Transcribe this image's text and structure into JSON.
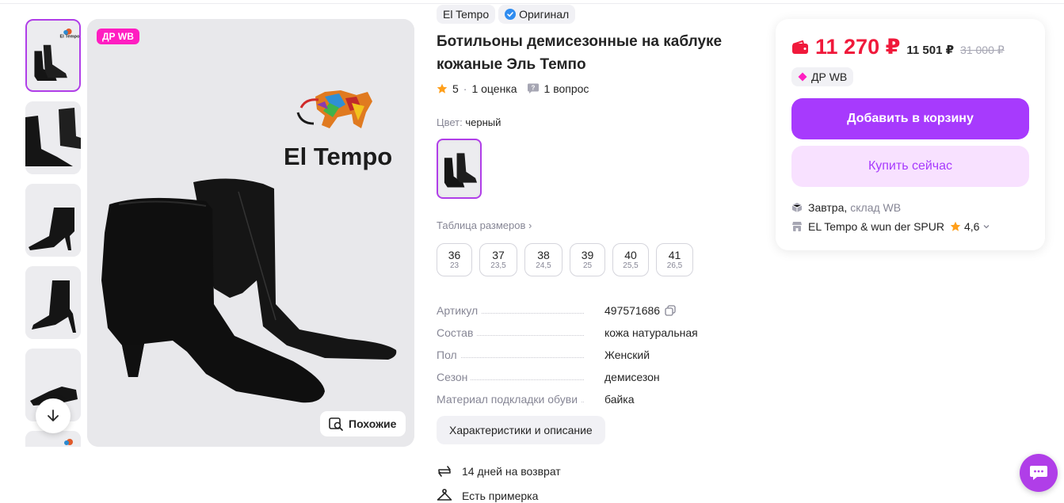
{
  "gallery": {
    "badge": "ДР WB",
    "similar_label": "Похожие",
    "brand_logo_text": "El Tempo"
  },
  "product": {
    "brand_chip": "El Tempo",
    "original_chip": "Оригинал",
    "title": "Ботильоны демисезонные на каблуке кожаные Эль Темпо",
    "rating": "5",
    "reviews": "1 оценка",
    "questions": "1 вопрос",
    "color_label": "Цвет:",
    "color_value": "черный",
    "size_table_label": "Таблица размеров",
    "sizes": [
      {
        "ru": "36",
        "cm": "23"
      },
      {
        "ru": "37",
        "cm": "23,5"
      },
      {
        "ru": "38",
        "cm": "24,5"
      },
      {
        "ru": "39",
        "cm": "25"
      },
      {
        "ru": "40",
        "cm": "25,5"
      },
      {
        "ru": "41",
        "cm": "26,5"
      }
    ],
    "params": [
      {
        "key": "Артикул",
        "value": "497571686"
      },
      {
        "key": "Состав",
        "value": "кожа натуральная"
      },
      {
        "key": "Пол",
        "value": "Женский"
      },
      {
        "key": "Сезон",
        "value": "демисезон"
      },
      {
        "key": "Материал подкладки обуви",
        "value": "байка"
      }
    ],
    "characteristics_button": "Характеристики и описание",
    "features": [
      {
        "icon": "return-arrows-icon",
        "label": "14 дней на возврат"
      },
      {
        "icon": "hanger-icon",
        "label": "Есть примерка"
      }
    ]
  },
  "price_card": {
    "price": "11 270 ₽",
    "wallet_price": "11 501 ₽",
    "old_price": "31 000 ₽",
    "dr_label": "ДР WB",
    "add_to_cart": "Добавить в корзину",
    "buy_now": "Купить сейчас",
    "delivery_day": "Завтра,",
    "delivery_warehouse": "склад WB",
    "seller_name": "EL Tempo & wun der SPUR",
    "seller_rating": "4,6"
  },
  "colors": {
    "accent": "#a73afd",
    "price_red": "#f0193b",
    "badge_pink": "#ff1ec1"
  }
}
